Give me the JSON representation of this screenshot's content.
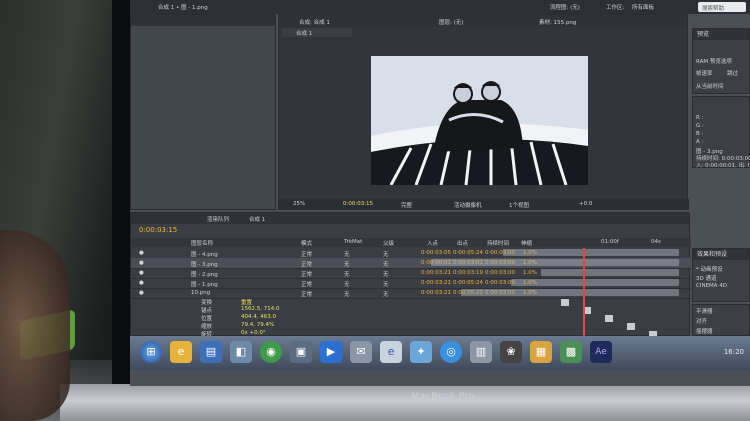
{
  "device": {
    "brand": "MacBook Pro"
  },
  "app": {
    "project_tab": "合成 1 • 图 - 1.png",
    "comp_tab_prefix": "合成: 合成 1",
    "comp_tab": "合成 1",
    "layer_label": "图层: (无)",
    "footage_label": "素材: 155.png",
    "flowchart_label": "流程图: (无)",
    "workspace_label": "工作区:",
    "workspace_value": "所有面板",
    "search_placeholder": "搜索帮助"
  },
  "preview_panel": {
    "title": "预览",
    "ram_label": "RAM 预览选项",
    "framerate_label": "帧速率",
    "framerate_value": "跳过",
    "from_current": "从当前时间"
  },
  "info_panel": {
    "r": "R :",
    "g": "G :",
    "b": "B :",
    "a": "A :",
    "layer_line": "图 - 3.png",
    "duration_line": "持续时间: 0:00:03:00",
    "in_out_line": "入: 0:00:00:01, 出: 0:00:03:01"
  },
  "comp_footer": {
    "zoom": "25%",
    "timecode": "0:00:03:15",
    "quality": "完整",
    "camera": "活动摄像机",
    "views": "1个视图",
    "exposure": "+0.0"
  },
  "timeline": {
    "tab_render": "渲染队列",
    "tab_comp": "合成 1",
    "current_time": "0:00:03:15",
    "columns": [
      "图层名称",
      "模式",
      "T",
      "TrkMat",
      "父级",
      "入点",
      "出点",
      "持续时间",
      "伸缩"
    ],
    "layers": [
      {
        "name": "图 - 4.png",
        "mode": "正常",
        "trkmat": "无",
        "parent": "无",
        "in": "0:00:03:05",
        "out": "0:00:05:24",
        "dur": "0:00:03:00",
        "stretch": "1.0%"
      },
      {
        "name": "图 - 3.png",
        "mode": "正常",
        "trkmat": "无",
        "parent": "无",
        "in": "0:00:00:01",
        "out": "0:00:03:01",
        "dur": "0:00:03:00",
        "stretch": "1.0%"
      },
      {
        "name": "图 - 2.png",
        "mode": "正常",
        "trkmat": "无",
        "parent": "无",
        "in": "0:00:03:21",
        "out": "0:00:03:19",
        "dur": "0:00:03:00",
        "stretch": "1.0%"
      },
      {
        "name": "图 - 1.png",
        "mode": "正常",
        "trkmat": "无",
        "parent": "无",
        "in": "0:00:03:21",
        "out": "0:00:05:24",
        "dur": "0:00:03:00",
        "stretch": "1.0%"
      },
      {
        "name": "10.png",
        "mode": "正常",
        "trkmat": "无",
        "parent": "无",
        "in": "0:00:03:21",
        "out": "0:00:05:22",
        "dur": "0:00:03:00",
        "stretch": "1.0%"
      }
    ],
    "transform_props": [
      {
        "label": "变换",
        "value": "重置"
      },
      {
        "label": "锚点",
        "value": "1562.5, 714.0"
      },
      {
        "label": "位置",
        "value": "404.4, 463.0"
      },
      {
        "label": "缩放",
        "value": "79.4, 79.4%"
      },
      {
        "label": "旋转",
        "value": "0x +0.0°"
      }
    ],
    "ruler_marks": [
      "01:00f",
      "04s"
    ]
  },
  "effects_panel": {
    "title": "效果和预设",
    "items": [
      "* 动画预设",
      "3D 通道",
      "CINEMA 4D"
    ]
  },
  "side_panels": [
    "平滑器",
    "对齐",
    "平滑器",
    "摇摆器",
    "动态草图",
    "蒙版插值"
  ],
  "taskbar": {
    "clock": "16:20"
  },
  "colors": {
    "accent_orange": "#f2b23a",
    "playhead": "#e04b3a",
    "timecode_yellow": "#e9e25a"
  }
}
